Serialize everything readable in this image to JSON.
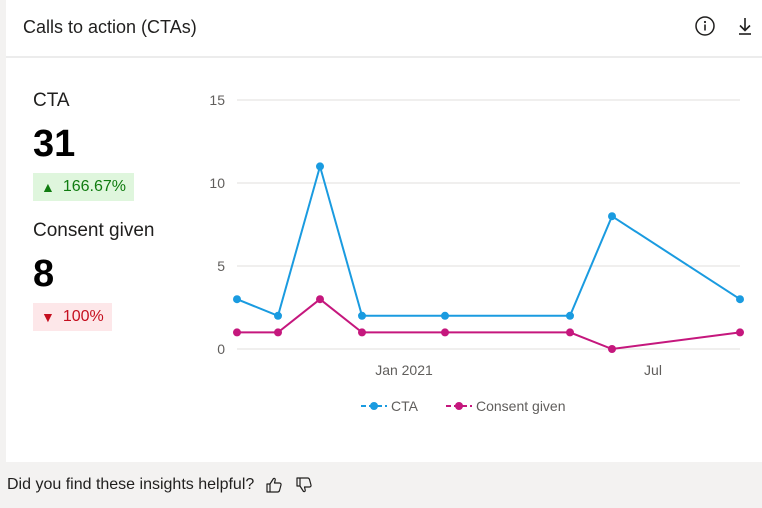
{
  "card": {
    "title": "Calls to action (CTAs)",
    "info_icon": "info-icon",
    "download_icon": "download-icon"
  },
  "metrics": {
    "cta": {
      "label": "CTA",
      "value": "31",
      "delta": "166.67%",
      "direction": "up"
    },
    "consent": {
      "label": "Consent given",
      "value": "8",
      "delta": "100%",
      "direction": "down"
    }
  },
  "chart_data": {
    "type": "line",
    "x_tick_labels": [
      "Jan 2021",
      "Jul"
    ],
    "ylim": [
      0,
      15
    ],
    "y_ticks": [
      0,
      5,
      10,
      15
    ],
    "grid": true,
    "legend_position": "bottom",
    "series": [
      {
        "name": "CTA",
        "color": "#1a9be0",
        "values": [
          3,
          2,
          11,
          2,
          2,
          2,
          8,
          3
        ]
      },
      {
        "name": "Consent given",
        "color": "#c5177d",
        "values": [
          1,
          1,
          3,
          1,
          1,
          1,
          0,
          1
        ]
      }
    ]
  },
  "feedback": {
    "question": "Did you find these insights helpful?",
    "thumbs_up_icon": "thumbs-up-icon",
    "thumbs_down_icon": "thumbs-down-icon"
  }
}
